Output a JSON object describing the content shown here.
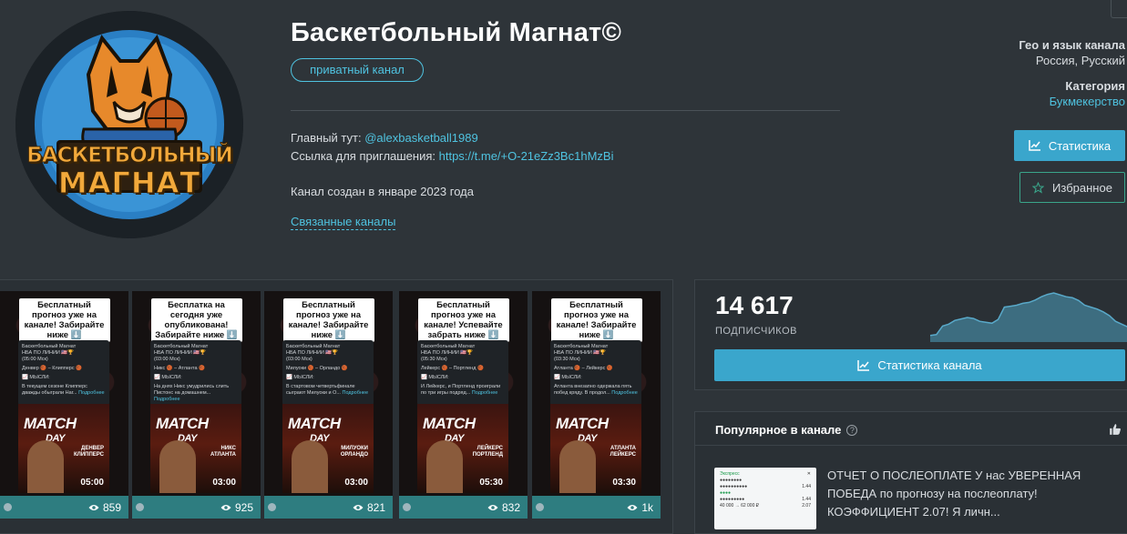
{
  "header": {
    "title": "Баскетбольный Магнат©",
    "private_badge": "приватный канал",
    "avatar_line1": "БАСКЕТБОЛЬНЫЙ",
    "avatar_line2": "МАГНАТ",
    "main_label": "Главный тут: ",
    "main_link": "@alexbasketball1989",
    "invite_label": "Ссылка для приглашения: ",
    "invite_link": "https://t.me/+O-21eZz3Bc1hMzBi",
    "created": "Канал создан в январе 2023 года",
    "related": "Связанные каналы"
  },
  "side": {
    "geo_label": "Гео и язык канала",
    "geo_value": "Россия, Русский",
    "category_label": "Категория",
    "category_value": "Букмекерство",
    "stats_button": "Статистика",
    "favorites_button": "Избранное"
  },
  "posts": [
    {
      "caption": "Бесплатный прогноз уже на канале! Забирайте ниже ⬇️",
      "card_title": "Баскетбольный Магнат",
      "card_league": "НБА ПО ЛИНИИ 🇺🇸🏆",
      "card_time": "(05:00 Мск)",
      "card_match": "Денвер 🏀 – Клипперс 🏀",
      "card_thoughts": "📈 МЫСЛИ:",
      "card_text": "В текущем сезоне Клипперс дважды обыграли Наг...",
      "card_more": "Подробнее",
      "teams": "ДЕНВЕР КЛИППЕРС",
      "time": "05:00",
      "views": "859"
    },
    {
      "caption": "Бесплатка на сегодня уже опубликована! Забирайте ниже ⬇️",
      "card_title": "Баскетбольный Магнат",
      "card_league": "НБА ПО ЛИНИИ 🇺🇸🏆",
      "card_time": "(03:00 Мск)",
      "card_match": "Никс 🏀 – Атланта 🏀",
      "card_thoughts": "📈 МЫСЛИ:",
      "card_text": "На днях Никс умудрились слить Пистонс на домашнем...",
      "card_more": "Подробнее",
      "teams": "НИКС АТЛАНТА",
      "time": "03:00",
      "views": "925"
    },
    {
      "caption": "Бесплатный прогноз уже на канале! Забирайте ниже ⬇️",
      "card_title": "Баскетбольный Магнат",
      "card_league": "НБА ПО ЛИНИИ 🇺🇸🏆",
      "card_time": "(03:00 Мск)",
      "card_match": "Милуоки 🏀 – Орландо 🏀",
      "card_thoughts": "📈 МЫСЛИ:",
      "card_text": "В стартовом четвертьфинале сыграют Милуоки и О...",
      "card_more": "Подробнее",
      "teams": "МИЛУОКИ ОРЛАНДО",
      "time": "03:00",
      "views": "821"
    },
    {
      "caption": "Бесплатный прогноз уже на канале! Успевайте забрать ниже ⬇️",
      "card_title": "Баскетбольный Магнат",
      "card_league": "НБА ПО ЛИНИИ 🇺🇸🏆",
      "card_time": "(05:30 Мск)",
      "card_match": "Лейкерс 🏀 – Портленд 🏀",
      "card_thoughts": "📈 МЫСЛИ:",
      "card_text": "И Лейкерс, и Портленд проиграли по три игры подряд...",
      "card_more": "Подробнее",
      "teams": "ЛЕЙКЕРС ПОРТЛЕНД",
      "time": "05:30",
      "views": "832"
    },
    {
      "caption": "Бесплатный прогноз уже на канале! Забирайте ниже ⬇️",
      "card_title": "Баскетбольный Магнат",
      "card_league": "НБА ПО ЛИНИИ 🇺🇸🏆",
      "card_time": "(03:30 Мск)",
      "card_match": "Атланта 🏀 – Лейкерс 🏀",
      "card_thoughts": "📈 МЫСЛИ:",
      "card_text": "Атланта внезапно одержала пять побед кряду. В продол...",
      "card_more": "Подробнее",
      "teams": "АТЛАНТА ЛЕЙКЕРС",
      "time": "03:30",
      "views": "1k"
    }
  ],
  "subscribers": {
    "count": "14 617",
    "label": "ПОДПИСЧИКОВ",
    "stats_button": "Статистика канала",
    "trend": [
      0.1,
      0.12,
      0.3,
      0.34,
      0.42,
      0.45,
      0.48,
      0.46,
      0.4,
      0.38,
      0.36,
      0.44,
      0.7,
      0.72,
      0.74,
      0.78,
      0.8,
      0.85,
      0.92,
      0.97,
      1.0,
      0.96,
      0.92,
      0.9,
      0.84,
      0.74,
      0.7,
      0.66,
      0.6,
      0.52,
      0.4,
      0.34,
      0.28
    ]
  },
  "popular": {
    "title": "Популярное в канале",
    "help": "?",
    "thumb_title": "Экспресс",
    "thumb_total": "40 000 → 62 000 ₽",
    "thumb_coef": "2.07",
    "text": "ОТЧЕТ О ПОСЛЕОПЛАТЕ У нас УВЕРЕННАЯ ПОБЕДА по прогнозу на послеоплату! КОЭФФИЦИЕНТ 2.07! Я личн..."
  },
  "colors": {
    "background": "#2e3439",
    "panel": "#2a3035",
    "accent": "#3aa6cc",
    "link": "#4fc3e0",
    "views_bar": "#2e7d80",
    "favorite_border": "#3aa58a"
  }
}
